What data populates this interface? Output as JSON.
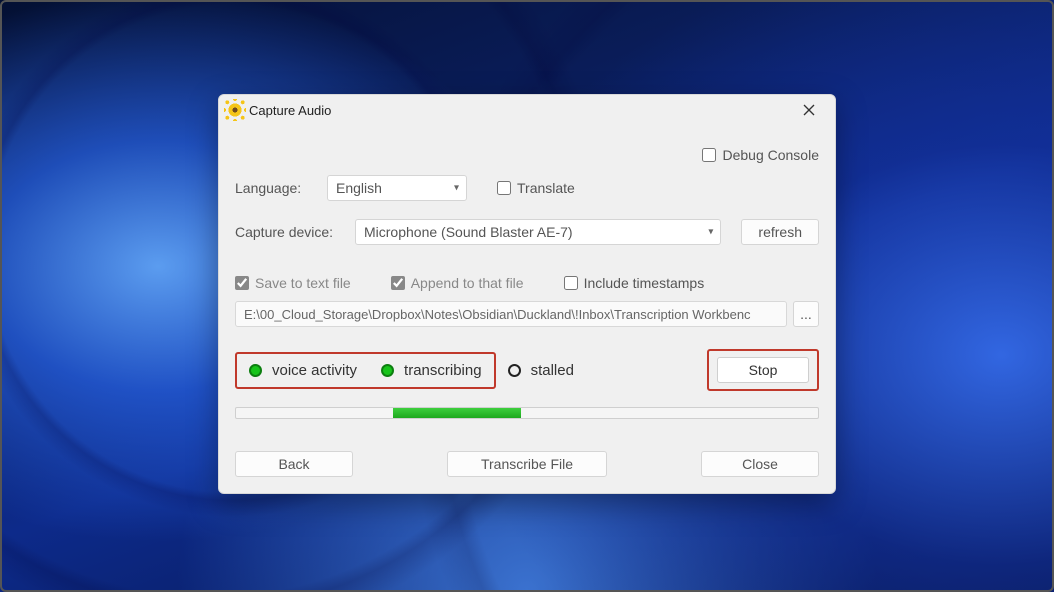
{
  "window": {
    "title": "Capture Audio"
  },
  "options": {
    "debug_console_label": "Debug Console",
    "debug_console_checked": false
  },
  "language": {
    "label": "Language:",
    "selected": "English",
    "translate_label": "Translate",
    "translate_checked": false
  },
  "device": {
    "label": "Capture device:",
    "selected": "Microphone (Sound Blaster AE-7)",
    "refresh_label": "refresh"
  },
  "file": {
    "save_label": "Save to text file",
    "save_checked": true,
    "append_label": "Append to that file",
    "append_checked": true,
    "timestamps_label": "Include timestamps",
    "timestamps_checked": false,
    "path": "E:\\00_Cloud_Storage\\Dropbox\\Notes\\Obsidian\\Duckland\\!Inbox\\Transcription Workbenc",
    "browse_label": "..."
  },
  "status": {
    "voice_activity": {
      "label": "voice activity",
      "state": "active"
    },
    "transcribing": {
      "label": "transcribing",
      "state": "active"
    },
    "stalled": {
      "label": "stalled",
      "state": "inactive"
    }
  },
  "controls": {
    "stop_label": "Stop"
  },
  "progress": {
    "indeterminate_left_pct": 27,
    "indeterminate_width_pct": 22
  },
  "buttons": {
    "back": "Back",
    "transcribe_file": "Transcribe File",
    "close": "Close"
  }
}
